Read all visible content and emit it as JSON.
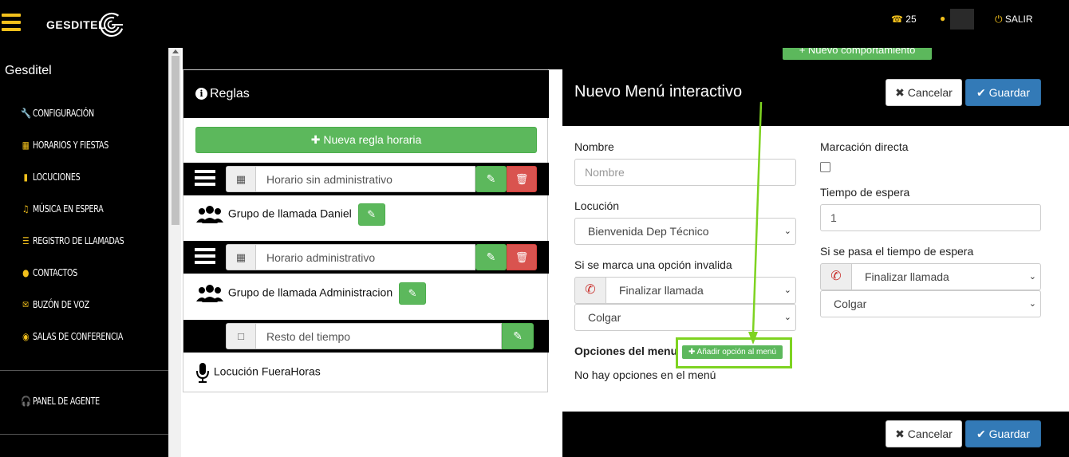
{
  "header": {
    "logo_text": "GESDITEL",
    "phone_count": "25",
    "logout_label": "SALIR",
    "icons": {
      "menu": "hamburger-icon",
      "phone": "phone-icon",
      "user": "user-icon",
      "power": "power-icon"
    },
    "accent_color": "#f2c01c"
  },
  "sidebar": {
    "brand": "Gesditel",
    "items": [
      {
        "icon": "wrench-icon",
        "label": "CONFIGURACIÓN"
      },
      {
        "icon": "calendar-icon",
        "label": "HORARIOS Y FIESTAS"
      },
      {
        "icon": "microphone-icon",
        "label": "LOCUCIONES"
      },
      {
        "icon": "music-icon",
        "label": "MÚSICA EN ESPERA"
      },
      {
        "icon": "list-icon",
        "label": "REGISTRO DE LLAMADAS"
      },
      {
        "icon": "users-icon",
        "label": "CONTACTOS"
      },
      {
        "icon": "envelope-icon",
        "label": "BUZÓN DE VOZ"
      },
      {
        "icon": "comments-icon",
        "label": "SALAS DE CONFERENCIA"
      }
    ],
    "agent_panel": {
      "icon": "headphones-icon",
      "label": "PANEL DE AGENTE"
    }
  },
  "main": {
    "new_behavior_button": "Nuevo comportamiento"
  },
  "rules": {
    "title": "Reglas",
    "new_rule_button": "Nueva regla horaria",
    "schedules": [
      {
        "name": "Horario sin administrativo",
        "group": "Grupo de llamada Daniel"
      },
      {
        "name": "Horario administrativo",
        "group": "Grupo de llamada Administracion"
      },
      {
        "name": "Resto del tiempo",
        "locution": "Locución FueraHoras"
      }
    ]
  },
  "modal": {
    "title": "Nuevo Menú interactivo",
    "cancel_label": "Cancelar",
    "save_label": "Guardar",
    "name_label": "Nombre",
    "name_placeholder": "Nombre",
    "locution_label": "Locución",
    "locution_value": "Bienvenida Dep Técnico",
    "invalid_option_label": "Si se marca una opción invalida",
    "invalid_action": "Finalizar llamada",
    "invalid_sub": "Colgar",
    "direct_dial_label": "Marcación directa",
    "direct_dial_checked": false,
    "wait_time_label": "Tiempo de espera",
    "wait_time_value": "1",
    "timeout_label": "Si se pasa el tiempo de espera",
    "timeout_action": "Finalizar llamada",
    "timeout_sub": "Colgar",
    "menu_options_label": "Opciones del menu",
    "add_option_button": "Añadir opción al menú",
    "no_options_text": "No hay opciones en el menú",
    "highlight_color": "#7ed321"
  }
}
